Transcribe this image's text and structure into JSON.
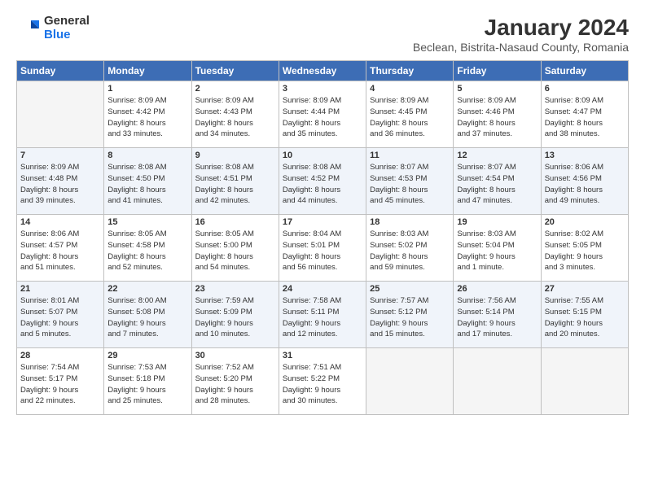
{
  "header": {
    "logo": {
      "general": "General",
      "blue": "Blue"
    },
    "title": "January 2024",
    "subtitle": "Beclean, Bistrita-Nasaud County, Romania"
  },
  "calendar": {
    "days_of_week": [
      "Sunday",
      "Monday",
      "Tuesday",
      "Wednesday",
      "Thursday",
      "Friday",
      "Saturday"
    ],
    "weeks": [
      [
        {
          "day": "",
          "info": ""
        },
        {
          "day": "1",
          "info": "Sunrise: 8:09 AM\nSunset: 4:42 PM\nDaylight: 8 hours\nand 33 minutes."
        },
        {
          "day": "2",
          "info": "Sunrise: 8:09 AM\nSunset: 4:43 PM\nDaylight: 8 hours\nand 34 minutes."
        },
        {
          "day": "3",
          "info": "Sunrise: 8:09 AM\nSunset: 4:44 PM\nDaylight: 8 hours\nand 35 minutes."
        },
        {
          "day": "4",
          "info": "Sunrise: 8:09 AM\nSunset: 4:45 PM\nDaylight: 8 hours\nand 36 minutes."
        },
        {
          "day": "5",
          "info": "Sunrise: 8:09 AM\nSunset: 4:46 PM\nDaylight: 8 hours\nand 37 minutes."
        },
        {
          "day": "6",
          "info": "Sunrise: 8:09 AM\nSunset: 4:47 PM\nDaylight: 8 hours\nand 38 minutes."
        }
      ],
      [
        {
          "day": "7",
          "info": "Sunrise: 8:09 AM\nSunset: 4:48 PM\nDaylight: 8 hours\nand 39 minutes."
        },
        {
          "day": "8",
          "info": "Sunrise: 8:08 AM\nSunset: 4:50 PM\nDaylight: 8 hours\nand 41 minutes."
        },
        {
          "day": "9",
          "info": "Sunrise: 8:08 AM\nSunset: 4:51 PM\nDaylight: 8 hours\nand 42 minutes."
        },
        {
          "day": "10",
          "info": "Sunrise: 8:08 AM\nSunset: 4:52 PM\nDaylight: 8 hours\nand 44 minutes."
        },
        {
          "day": "11",
          "info": "Sunrise: 8:07 AM\nSunset: 4:53 PM\nDaylight: 8 hours\nand 45 minutes."
        },
        {
          "day": "12",
          "info": "Sunrise: 8:07 AM\nSunset: 4:54 PM\nDaylight: 8 hours\nand 47 minutes."
        },
        {
          "day": "13",
          "info": "Sunrise: 8:06 AM\nSunset: 4:56 PM\nDaylight: 8 hours\nand 49 minutes."
        }
      ],
      [
        {
          "day": "14",
          "info": "Sunrise: 8:06 AM\nSunset: 4:57 PM\nDaylight: 8 hours\nand 51 minutes."
        },
        {
          "day": "15",
          "info": "Sunrise: 8:05 AM\nSunset: 4:58 PM\nDaylight: 8 hours\nand 52 minutes."
        },
        {
          "day": "16",
          "info": "Sunrise: 8:05 AM\nSunset: 5:00 PM\nDaylight: 8 hours\nand 54 minutes."
        },
        {
          "day": "17",
          "info": "Sunrise: 8:04 AM\nSunset: 5:01 PM\nDaylight: 8 hours\nand 56 minutes."
        },
        {
          "day": "18",
          "info": "Sunrise: 8:03 AM\nSunset: 5:02 PM\nDaylight: 8 hours\nand 59 minutes."
        },
        {
          "day": "19",
          "info": "Sunrise: 8:03 AM\nSunset: 5:04 PM\nDaylight: 9 hours\nand 1 minute."
        },
        {
          "day": "20",
          "info": "Sunrise: 8:02 AM\nSunset: 5:05 PM\nDaylight: 9 hours\nand 3 minutes."
        }
      ],
      [
        {
          "day": "21",
          "info": "Sunrise: 8:01 AM\nSunset: 5:07 PM\nDaylight: 9 hours\nand 5 minutes."
        },
        {
          "day": "22",
          "info": "Sunrise: 8:00 AM\nSunset: 5:08 PM\nDaylight: 9 hours\nand 7 minutes."
        },
        {
          "day": "23",
          "info": "Sunrise: 7:59 AM\nSunset: 5:09 PM\nDaylight: 9 hours\nand 10 minutes."
        },
        {
          "day": "24",
          "info": "Sunrise: 7:58 AM\nSunset: 5:11 PM\nDaylight: 9 hours\nand 12 minutes."
        },
        {
          "day": "25",
          "info": "Sunrise: 7:57 AM\nSunset: 5:12 PM\nDaylight: 9 hours\nand 15 minutes."
        },
        {
          "day": "26",
          "info": "Sunrise: 7:56 AM\nSunset: 5:14 PM\nDaylight: 9 hours\nand 17 minutes."
        },
        {
          "day": "27",
          "info": "Sunrise: 7:55 AM\nSunset: 5:15 PM\nDaylight: 9 hours\nand 20 minutes."
        }
      ],
      [
        {
          "day": "28",
          "info": "Sunrise: 7:54 AM\nSunset: 5:17 PM\nDaylight: 9 hours\nand 22 minutes."
        },
        {
          "day": "29",
          "info": "Sunrise: 7:53 AM\nSunset: 5:18 PM\nDaylight: 9 hours\nand 25 minutes."
        },
        {
          "day": "30",
          "info": "Sunrise: 7:52 AM\nSunset: 5:20 PM\nDaylight: 9 hours\nand 28 minutes."
        },
        {
          "day": "31",
          "info": "Sunrise: 7:51 AM\nSunset: 5:22 PM\nDaylight: 9 hours\nand 30 minutes."
        },
        {
          "day": "",
          "info": ""
        },
        {
          "day": "",
          "info": ""
        },
        {
          "day": "",
          "info": ""
        }
      ]
    ]
  }
}
